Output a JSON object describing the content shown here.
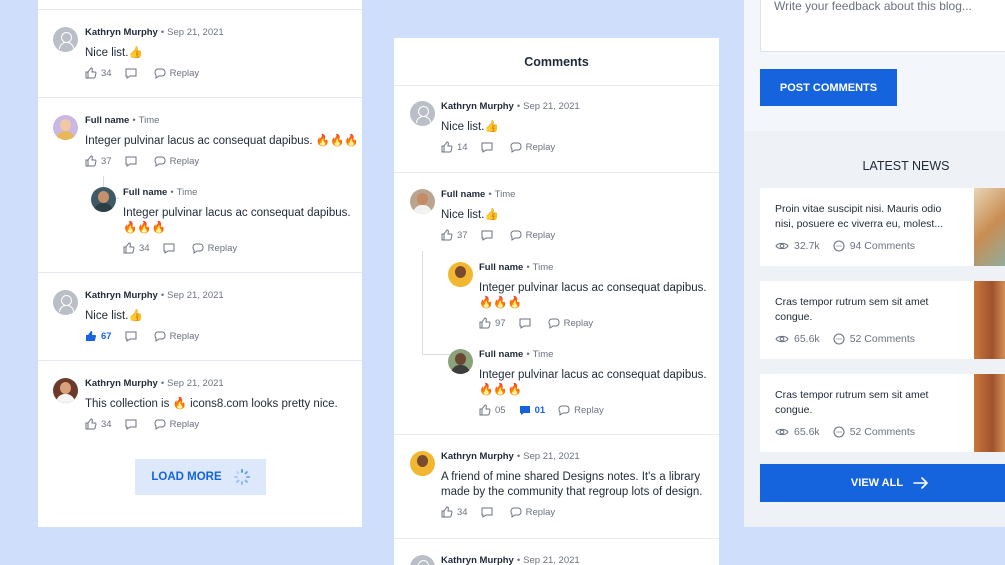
{
  "left": {
    "comments": [
      {
        "name": "Kathryn Murphy",
        "date": "Sep 21, 2021",
        "text": "Nice list.👍",
        "likes": "34",
        "dislikes": "",
        "reply": "Replay"
      },
      {
        "name": "Full name",
        "date": "Time",
        "text": "Integer pulvinar lacus ac consequat dapibus. 🔥🔥🔥",
        "likes": "37",
        "dislikes": "",
        "reply": "Replay"
      },
      {
        "name": "Full name",
        "date": "Time",
        "text": "Integer pulvinar lacus ac consequat dapibus. 🔥🔥🔥",
        "likes": "34",
        "dislikes": "",
        "reply": "Replay"
      },
      {
        "name": "Kathryn Murphy",
        "date": "Sep 21, 2021",
        "text": "Nice list.👍",
        "likes": "67",
        "dislikes": "",
        "reply": "Replay"
      },
      {
        "name": "Kathryn Murphy",
        "date": "Sep 21, 2021",
        "text": "This collection is 🔥 icons8.com looks pretty nice.",
        "likes": "34",
        "dislikes": "",
        "reply": "Replay"
      }
    ],
    "load_more": "LOAD MORE"
  },
  "middle": {
    "title": "Comments",
    "comments": [
      {
        "name": "Kathryn Murphy",
        "date": "Sep 21, 2021",
        "text": "Nice list.👍",
        "likes": "14",
        "dislikes": "",
        "reply": "Replay"
      },
      {
        "name": "Full name",
        "date": "Time",
        "text": "Nice list.👍",
        "likes": "37",
        "dislikes": "",
        "reply": "Replay"
      },
      {
        "name": "Full name",
        "date": "Time",
        "text": "Integer pulvinar lacus ac consequat dapibus. 🔥🔥🔥",
        "likes": "97",
        "dislikes": "",
        "reply": "Replay"
      },
      {
        "name": "Full name",
        "date": "Time",
        "text": "Integer pulvinar lacus ac consequat dapibus. 🔥🔥🔥",
        "likes": "05",
        "dislikes": "01",
        "reply": "Replay"
      },
      {
        "name": "Kathryn Murphy",
        "date": "Sep 21, 2021",
        "text": "A friend of mine shared Designs notes. It's a library made by the community that regroup lots of design.",
        "likes": "34",
        "dislikes": "",
        "reply": "Replay"
      },
      {
        "name": "Kathryn Murphy",
        "date": "Sep 21, 2021",
        "text": "",
        "likes": "",
        "dislikes": "",
        "reply": ""
      }
    ]
  },
  "right": {
    "feedback_placeholder": "Write your feedback about this blog...",
    "post_button": "POST COMMENTS",
    "news_title": "LATEST NEWS",
    "news": [
      {
        "title": "Proin vitae suscipit nisi. Mauris odio nisi, posuere ec viverra eu, molest...",
        "views": "32.7k",
        "comments": "94 Comments"
      },
      {
        "title": "Cras tempor rutrum sem sit amet congue.",
        "views": "65.6k",
        "comments": "52 Comments"
      },
      {
        "title": "Cras tempor rutrum sem sit amet congue.",
        "views": "65.6k",
        "comments": "52 Comments"
      }
    ],
    "view_all": "VIEW ALL"
  },
  "colors": {
    "accent": "#1663de",
    "background": "#cfdffb",
    "light_button": "#dde9fb"
  }
}
